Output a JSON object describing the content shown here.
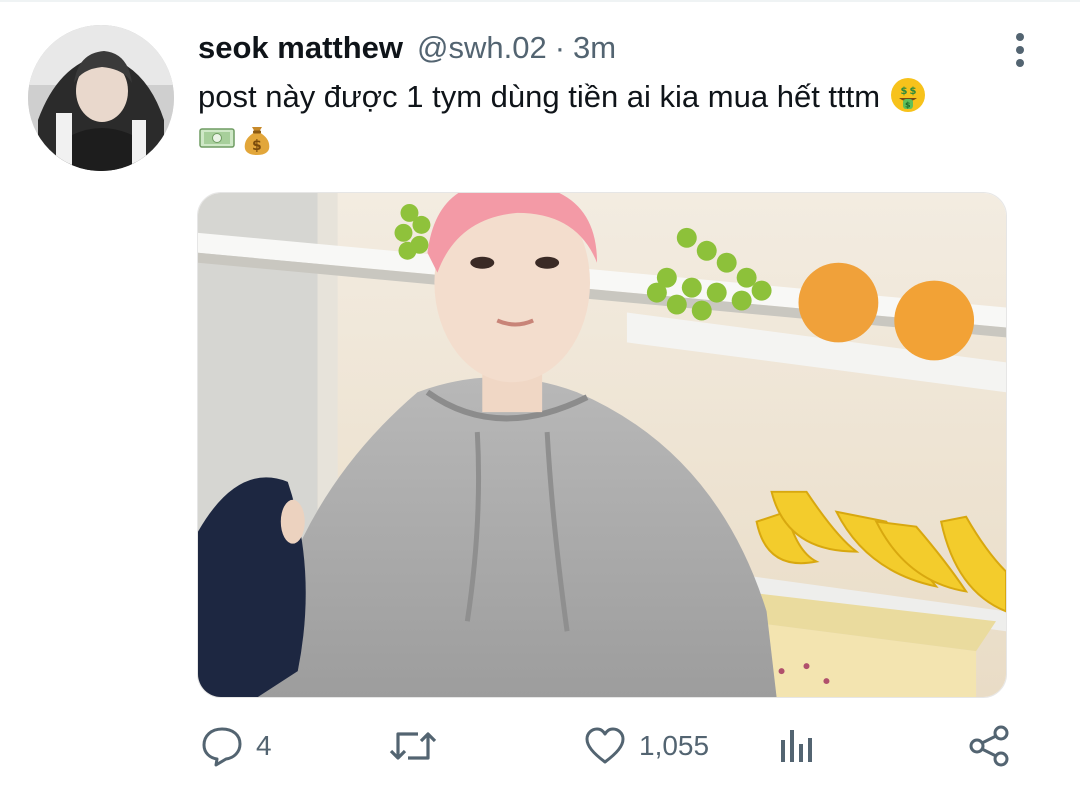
{
  "tweet": {
    "display_name": "seok matthew",
    "handle": "@swh.02",
    "separator": "·",
    "time": "3m",
    "text": "post này được 1 tym dùng tiền ai kia mua hết tttm",
    "emojis": [
      "money-mouth-face",
      "dollar-banknote",
      "money-bag"
    ]
  },
  "actions": {
    "reply_count": "4",
    "retweet_count": "",
    "like_count": "1,055"
  },
  "colors": {
    "text_primary": "#0f1419",
    "text_secondary": "#536471",
    "background": "#ffffff"
  },
  "icons": [
    "more-vertical-icon",
    "reply-icon",
    "retweet-icon",
    "like-icon",
    "views-icon",
    "share-icon"
  ]
}
